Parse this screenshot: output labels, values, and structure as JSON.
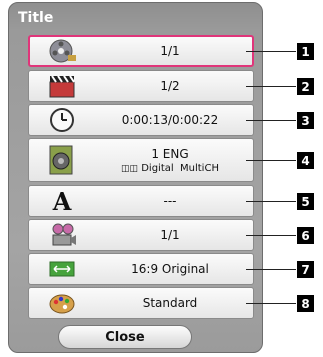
{
  "dialog": {
    "title": "Title",
    "close_label": "Close"
  },
  "rows": [
    {
      "value": "1/1",
      "icon": "title-disc-icon",
      "selected": true
    },
    {
      "value": "1/2",
      "icon": "chapter-clapper-icon"
    },
    {
      "value": "0:00:13/0:00:22",
      "icon": "clock-icon"
    },
    {
      "value": "1 ENG",
      "sub_codec": "Digital",
      "sub_channels": "MultiCH",
      "icon": "speaker-icon"
    },
    {
      "value": "---",
      "icon": "subtitle-a-icon"
    },
    {
      "value": "1/1",
      "icon": "camera-angle-icon"
    },
    {
      "value": "16:9 Original",
      "icon": "aspect-ratio-icon"
    },
    {
      "value": "Standard",
      "icon": "picture-mode-palette-icon"
    }
  ],
  "callouts": [
    "1",
    "2",
    "3",
    "4",
    "5",
    "6",
    "7",
    "8"
  ],
  "colors": {
    "selection": "#e0357a",
    "panel": "#a0a0a0",
    "callout_bg": "#000000"
  }
}
